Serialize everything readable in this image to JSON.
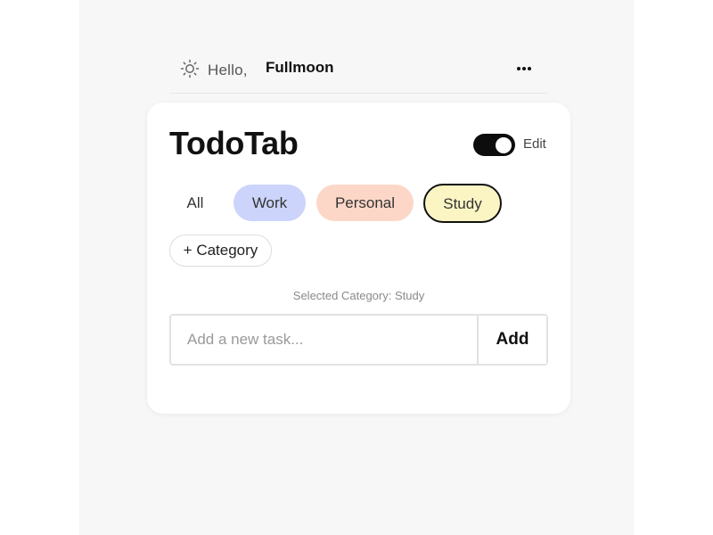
{
  "header": {
    "greeting_icon": "sun-icon",
    "greeting": "Hello,",
    "username": "Fullmoon",
    "menu_icon": "more-horizontal-icon"
  },
  "card": {
    "title": "TodoTab",
    "edit_toggle": {
      "on": true,
      "label": "Edit"
    },
    "categories": [
      {
        "label": "All",
        "color": ""
      },
      {
        "label": "Work",
        "color": "#ccd4fb"
      },
      {
        "label": "Personal",
        "color": "#fcd7c8"
      },
      {
        "label": "Study",
        "color": "#fbf5c4",
        "selected": true
      }
    ],
    "add_category_label": "+ Category",
    "selected_category_text": "Selected Category: Study",
    "task_input": {
      "value": "",
      "placeholder": "Add a new task..."
    },
    "add_button_label": "Add"
  },
  "colors": {
    "page_background": "#f7f7f7",
    "card_background": "#ffffff",
    "accent_dark": "#0d0d0d"
  }
}
